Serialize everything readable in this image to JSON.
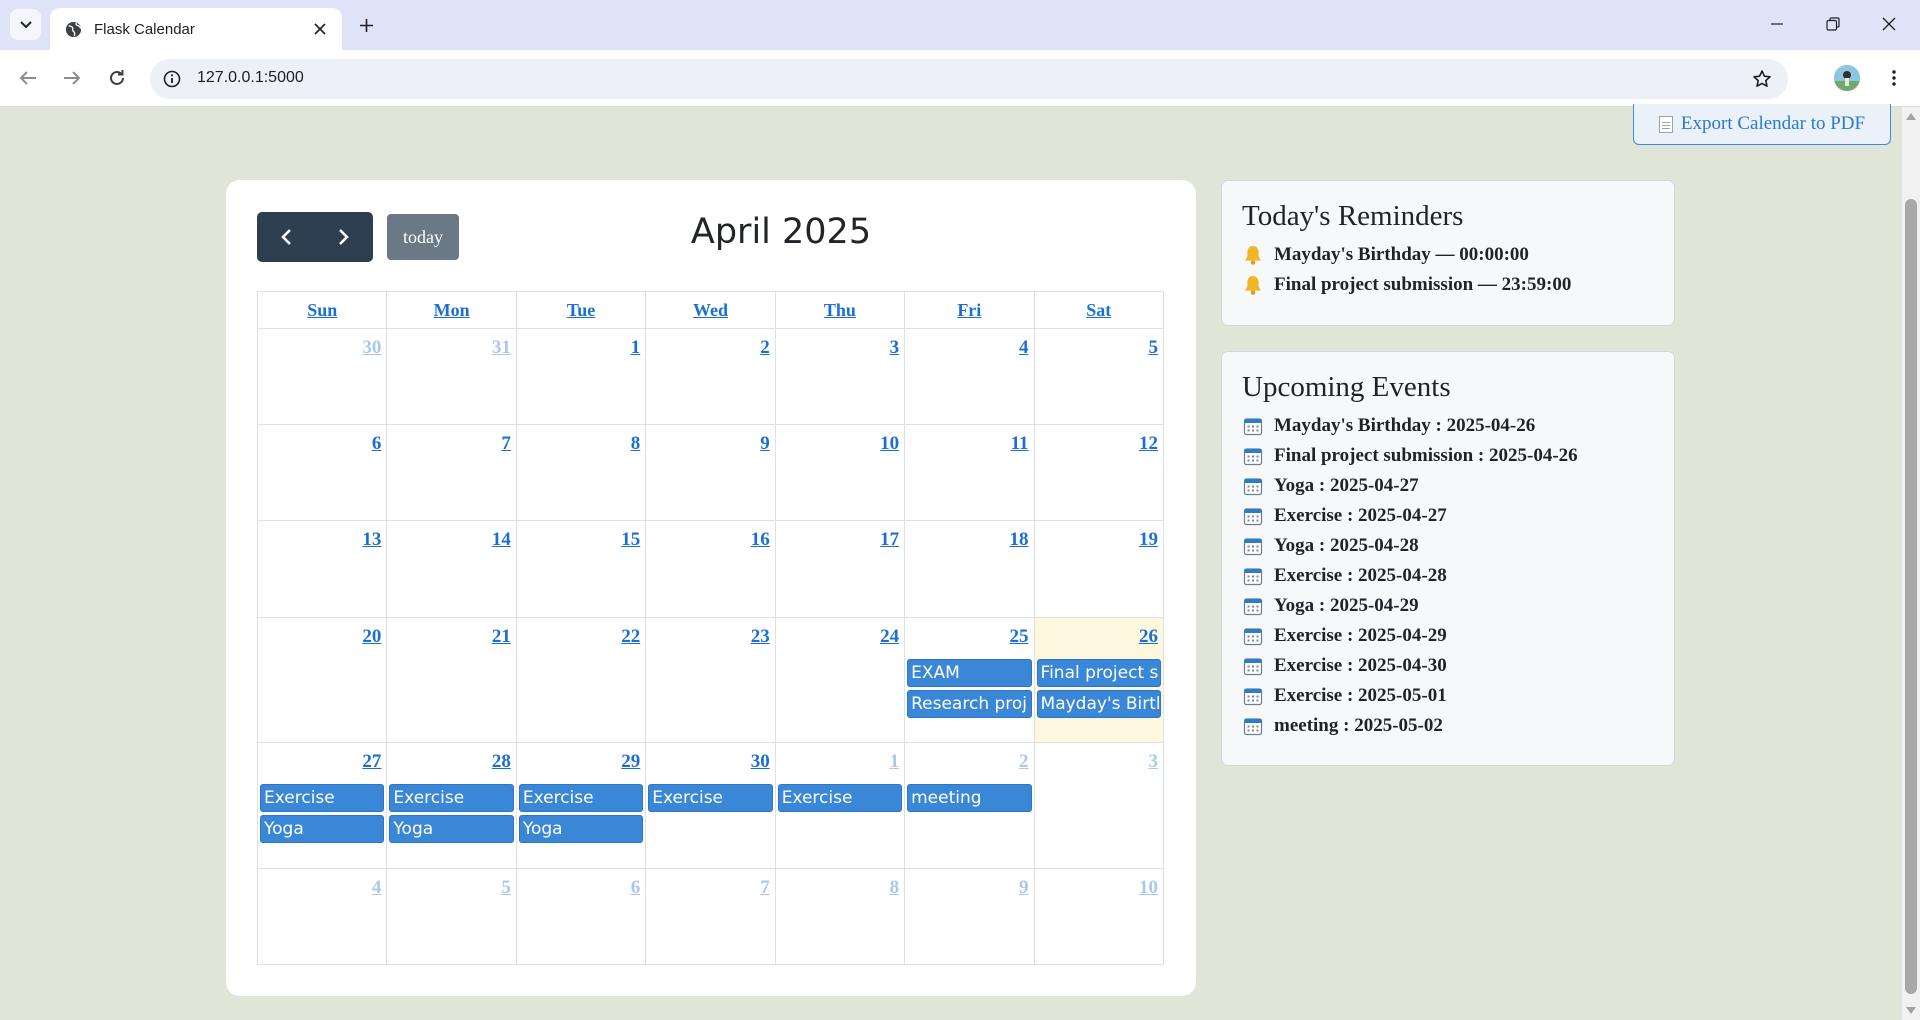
{
  "browser": {
    "tab_title": "Flask Calendar",
    "url": "127.0.0.1:5000"
  },
  "export_label": "Export Calendar to PDF",
  "calendar": {
    "title": "April 2025",
    "today_label": "today",
    "weekdays": [
      "Sun",
      "Mon",
      "Tue",
      "Wed",
      "Thu",
      "Fri",
      "Sat"
    ],
    "weeks": [
      [
        {
          "day": "30",
          "other": true,
          "events": []
        },
        {
          "day": "31",
          "other": true,
          "events": []
        },
        {
          "day": "1",
          "other": false,
          "events": []
        },
        {
          "day": "2",
          "other": false,
          "events": []
        },
        {
          "day": "3",
          "other": false,
          "events": []
        },
        {
          "day": "4",
          "other": false,
          "events": []
        },
        {
          "day": "5",
          "other": false,
          "events": []
        }
      ],
      [
        {
          "day": "6",
          "other": false,
          "events": []
        },
        {
          "day": "7",
          "other": false,
          "events": []
        },
        {
          "day": "8",
          "other": false,
          "events": []
        },
        {
          "day": "9",
          "other": false,
          "events": []
        },
        {
          "day": "10",
          "other": false,
          "events": []
        },
        {
          "day": "11",
          "other": false,
          "events": []
        },
        {
          "day": "12",
          "other": false,
          "events": []
        }
      ],
      [
        {
          "day": "13",
          "other": false,
          "events": []
        },
        {
          "day": "14",
          "other": false,
          "events": []
        },
        {
          "day": "15",
          "other": false,
          "events": []
        },
        {
          "day": "16",
          "other": false,
          "events": []
        },
        {
          "day": "17",
          "other": false,
          "events": []
        },
        {
          "day": "18",
          "other": false,
          "events": []
        },
        {
          "day": "19",
          "other": false,
          "events": []
        }
      ],
      [
        {
          "day": "20",
          "other": false,
          "events": []
        },
        {
          "day": "21",
          "other": false,
          "events": []
        },
        {
          "day": "22",
          "other": false,
          "events": []
        },
        {
          "day": "23",
          "other": false,
          "events": []
        },
        {
          "day": "24",
          "other": false,
          "events": []
        },
        {
          "day": "25",
          "other": false,
          "events": [
            "EXAM",
            "Research proj"
          ]
        },
        {
          "day": "26",
          "other": false,
          "today": true,
          "events": [
            "Final project s",
            "Mayday's Birtl"
          ]
        }
      ],
      [
        {
          "day": "27",
          "other": false,
          "events": [
            "Exercise",
            "Yoga"
          ]
        },
        {
          "day": "28",
          "other": false,
          "events": [
            "Exercise",
            "Yoga"
          ]
        },
        {
          "day": "29",
          "other": false,
          "events": [
            "Exercise",
            "Yoga"
          ]
        },
        {
          "day": "30",
          "other": false,
          "events": [
            "Exercise"
          ]
        },
        {
          "day": "1",
          "other": true,
          "events": [
            "Exercise"
          ]
        },
        {
          "day": "2",
          "other": true,
          "events": [
            "meeting"
          ]
        },
        {
          "day": "3",
          "other": true,
          "events": []
        }
      ],
      [
        {
          "day": "4",
          "other": true,
          "events": []
        },
        {
          "day": "5",
          "other": true,
          "events": []
        },
        {
          "day": "6",
          "other": true,
          "events": []
        },
        {
          "day": "7",
          "other": true,
          "events": []
        },
        {
          "day": "8",
          "other": true,
          "events": []
        },
        {
          "day": "9",
          "other": true,
          "events": []
        },
        {
          "day": "10",
          "other": true,
          "events": []
        }
      ]
    ]
  },
  "reminders": {
    "title": "Today's Reminders",
    "icon": "bell-icon",
    "items": [
      "Mayday's Birthday — 00:00:00",
      "Final project submission — 23:59:00"
    ]
  },
  "upcoming": {
    "title": "Upcoming Events",
    "icon": "calendar-icon",
    "items": [
      "Mayday's Birthday : 2025-04-26",
      "Final project submission : 2025-04-26",
      "Yoga : 2025-04-27",
      "Exercise : 2025-04-27",
      "Yoga : 2025-04-28",
      "Exercise : 2025-04-28",
      "Yoga : 2025-04-29",
      "Exercise : 2025-04-29",
      "Exercise : 2025-04-30",
      "Exercise : 2025-05-01",
      "meeting : 2025-05-02"
    ]
  },
  "colors": {
    "page_bg": "#e1e5d8",
    "event_bg": "#3a87d8",
    "nav_bg": "#2c3e50",
    "link": "#1a6ed8",
    "today_bg": "#fdf8dd"
  }
}
